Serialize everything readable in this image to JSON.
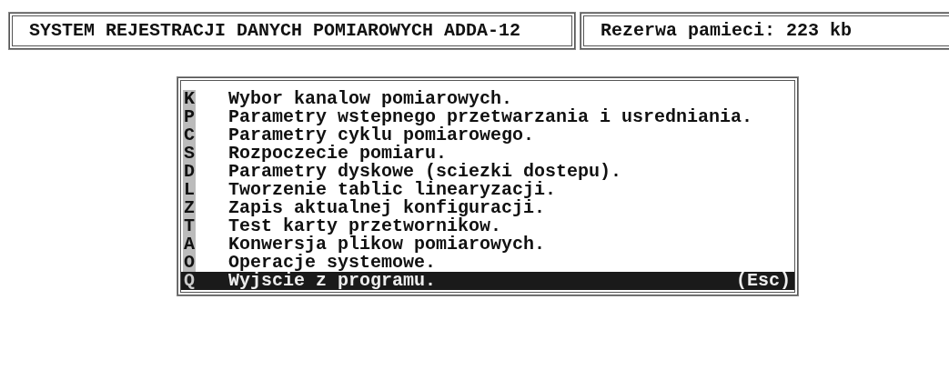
{
  "header": {
    "title": "SYSTEM REJESTRACJI DANYCH POMIAROWYCH ADDA-12",
    "memory": "Rezerwa pamieci: 223 kb"
  },
  "menu": [
    {
      "key": "K",
      "label": "Wybor kanalow pomiarowych.",
      "selected": false
    },
    {
      "key": "P",
      "label": "Parametry wstepnego przetwarzania i usredniania.",
      "selected": false
    },
    {
      "key": "C",
      "label": "Parametry cyklu pomiarowego.",
      "selected": false
    },
    {
      "key": "S",
      "label": "Rozpoczecie pomiaru.",
      "selected": false
    },
    {
      "key": "D",
      "label": "Parametry dyskowe (sciezki dostepu).",
      "selected": false
    },
    {
      "key": "L",
      "label": "Tworzenie tablic linearyzacji.",
      "selected": false
    },
    {
      "key": "Z",
      "label": "Zapis aktualnej konfiguracji.",
      "selected": false
    },
    {
      "key": "T",
      "label": "Test karty przetwornikow.",
      "selected": false
    },
    {
      "key": "A",
      "label": "Konwersja plikow pomiarowych.",
      "selected": false
    },
    {
      "key": "O",
      "label": "Operacje systemowe.",
      "selected": false
    },
    {
      "key": "Q",
      "label": "Wyjscie z programu.",
      "selected": true,
      "shortcut": "(Esc)"
    }
  ]
}
